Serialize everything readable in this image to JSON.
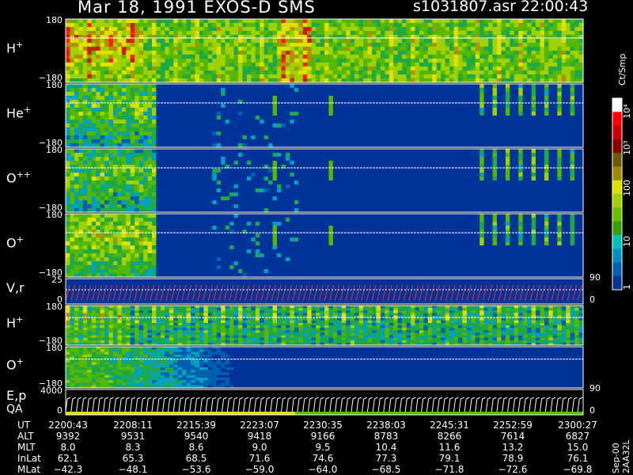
{
  "title": {
    "left": "Mar 18, 1991   EXOS-D SMS",
    "right": "s1031807.asr  22:00:43"
  },
  "panels": [
    {
      "id": "h-plus-1",
      "label": "H",
      "sup": "+",
      "ticks": [
        "180",
        "−180"
      ],
      "style": "hot"
    },
    {
      "id": "he-plus",
      "label": "He",
      "sup": "+",
      "ticks": [
        "180",
        "−180"
      ],
      "style": "sparse-he"
    },
    {
      "id": "o-plusplus",
      "label": "O",
      "sup": "++",
      "ticks": [
        "180",
        "−180"
      ],
      "style": "sparse-o2"
    },
    {
      "id": "o-plus-1",
      "label": "O",
      "sup": "+",
      "ticks": [
        "180",
        "−180"
      ],
      "style": "sparse-o"
    },
    {
      "id": "vr",
      "label": "V,r",
      "sup": "",
      "ticks": [
        "25",
        "0"
      ],
      "right_ticks": [
        "90",
        "0"
      ],
      "style": "vr"
    },
    {
      "id": "h-plus-2",
      "label": "H",
      "sup": "+",
      "ticks": [
        "180",
        "−180"
      ],
      "style": "stripes"
    },
    {
      "id": "o-plus-2",
      "label": "O",
      "sup": "+",
      "ticks": [
        "180",
        "−180"
      ],
      "style": "early"
    },
    {
      "id": "ep-qa",
      "label": "E,p",
      "label2": "QA",
      "sup": "",
      "ticks": [
        "4000",
        "0"
      ],
      "right_ticks": [
        "90",
        "0"
      ],
      "style": "ep"
    }
  ],
  "colorbar": {
    "unit": "Ct/Smp",
    "ticks": [
      "10⁴",
      "10³",
      "100",
      "10",
      "1"
    ],
    "colors": [
      "#ffffff",
      "#ff0000",
      "#c80000",
      "#8a0000",
      "#6b5a00",
      "#a08800",
      "#e0e000",
      "#a0d000",
      "#66c000",
      "#33a000",
      "#00c0c0",
      "#0090c0",
      "#0060b0",
      "#00349a"
    ]
  },
  "footer": {
    "rows": [
      {
        "label": "UT",
        "values": [
          "2200:43",
          "2208:11",
          "2215:39",
          "2223:07",
          "2230:35",
          "2238:03",
          "2245:31",
          "2252:59",
          "2300:27"
        ]
      },
      {
        "label": "ALT",
        "values": [
          "9392",
          "9531",
          "9540",
          "9418",
          "9166",
          "8783",
          "8266",
          "7614",
          "6827"
        ]
      },
      {
        "label": "MLT",
        "values": [
          "8.0",
          "8.3",
          "8.6",
          "9.0",
          "9.5",
          "10.4",
          "11.6",
          "13.2",
          "15.0"
        ]
      },
      {
        "label": "InLat",
        "values": [
          "62.1",
          "65.3",
          "68.5",
          "71.6",
          "74.6",
          "77.3",
          "79.1",
          "78.9",
          "76.1"
        ]
      },
      {
        "label": "MLat",
        "values": [
          "−42.3",
          "−48.1",
          "−53.6",
          "−59.0",
          "−64.0",
          "−68.5",
          "−71.8",
          "−72.6",
          "−69.8"
        ]
      }
    ],
    "stamp": "Sep-00  2AA32L"
  },
  "chart_data": {
    "type": "heatmap",
    "title": "Mar 18, 1991   EXOS-D SMS",
    "x": [
      "2200:43",
      "2208:11",
      "2215:39",
      "2223:07",
      "2230:35",
      "2238:03",
      "2245:31",
      "2252:59",
      "2300:27"
    ],
    "series": [
      {
        "name": "H+",
        "ylim": [
          -180,
          180
        ]
      },
      {
        "name": "He+",
        "ylim": [
          -180,
          180
        ]
      },
      {
        "name": "O++",
        "ylim": [
          -180,
          180
        ]
      },
      {
        "name": "O+",
        "ylim": [
          -180,
          180
        ]
      },
      {
        "name": "V,r",
        "ylim": [
          0,
          25
        ]
      },
      {
        "name": "H+",
        "ylim": [
          -180,
          180
        ]
      },
      {
        "name": "O+",
        "ylim": [
          -180,
          180
        ]
      },
      {
        "name": "E,p",
        "ylim": [
          0,
          4000
        ]
      }
    ],
    "colorbar": {
      "label": "Ct/Smp",
      "ticks": [
        "1",
        "10",
        "100",
        "10³",
        "10⁴"
      ]
    }
  }
}
